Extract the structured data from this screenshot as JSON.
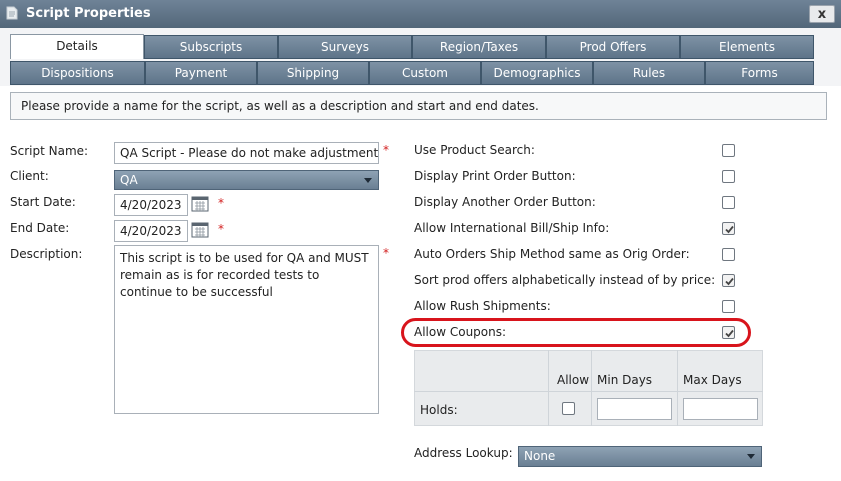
{
  "window": {
    "title": "Script Properties",
    "close_label": "x"
  },
  "tabs_row1": [
    {
      "label": "Details",
      "active": true
    },
    {
      "label": "Subscripts"
    },
    {
      "label": "Surveys"
    },
    {
      "label": "Region/Taxes"
    },
    {
      "label": "Prod Offers"
    },
    {
      "label": "Elements"
    }
  ],
  "tabs_row2": [
    {
      "label": "Dispositions"
    },
    {
      "label": "Payment"
    },
    {
      "label": "Shipping"
    },
    {
      "label": "Custom"
    },
    {
      "label": "Demographics"
    },
    {
      "label": "Rules"
    },
    {
      "label": "Forms"
    }
  ],
  "info": "Please provide a name for the script, as well as a description and start and end dates.",
  "form": {
    "script_name": {
      "label": "Script Name:",
      "value": "QA Script - Please do not make adjustments",
      "required": "*"
    },
    "client": {
      "label": "Client:",
      "value": "QA"
    },
    "start_date": {
      "label": "Start Date:",
      "value": "4/20/2023",
      "required": "*"
    },
    "end_date": {
      "label": "End Date:",
      "value": "4/20/2023",
      "required": "*"
    },
    "description": {
      "label": "Description:",
      "value": "This script is to be used for QA and MUST remain as is for recorded tests to continue to be successful",
      "required": "*"
    }
  },
  "options": [
    {
      "label": "Use Product Search:",
      "checked": false
    },
    {
      "label": "Display Print Order Button:",
      "checked": false
    },
    {
      "label": "Display Another Order Button:",
      "checked": false
    },
    {
      "label": "Allow International Bill/Ship Info:",
      "checked": true
    },
    {
      "label": "Auto Orders Ship Method same as Orig Order:",
      "checked": false
    },
    {
      "label": "Sort prod offers alphabetically instead of by price:",
      "checked": true
    },
    {
      "label": "Allow Rush Shipments:",
      "checked": false
    },
    {
      "label": "Allow Coupons:",
      "checked": true
    }
  ],
  "holds": {
    "headers": {
      "allow": "Allow",
      "min_days": "Min Days",
      "max_days": "Max Days"
    },
    "row_label": "Holds:",
    "allow_checked": false,
    "min_days": "",
    "max_days": ""
  },
  "address_lookup": {
    "label": "Address Lookup:",
    "value": "None"
  },
  "colors": {
    "highlight": "#d8141c",
    "required": "#d21f1f",
    "tab": "#5e7489"
  }
}
